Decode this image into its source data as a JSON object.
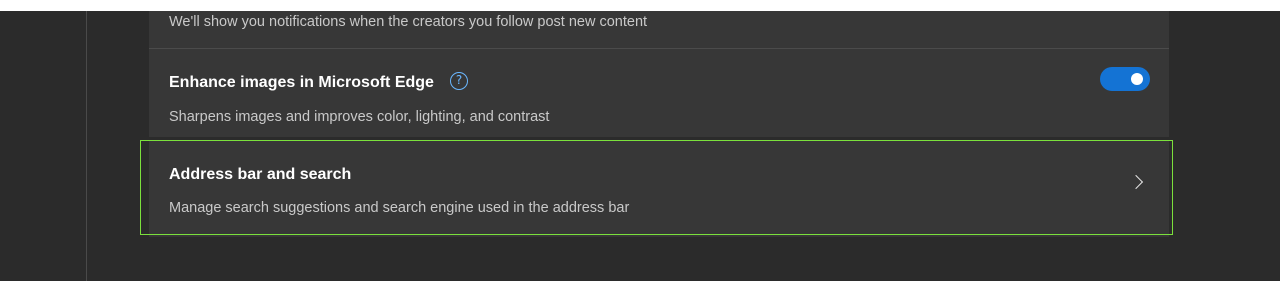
{
  "settings": {
    "notifications_row": {
      "description": "We'll show you notifications when the creators you follow post new content"
    },
    "enhance_images": {
      "title": "Enhance images in Microsoft Edge",
      "help_icon": "question-mark-circle",
      "help_glyph": "?",
      "description": "Sharpens images and improves color, lighting, and contrast",
      "toggle_state": "on",
      "toggle_color": "#1473d4"
    },
    "address_bar": {
      "title": "Address bar and search",
      "description": "Manage search suggestions and search engine used in the address bar",
      "icon": "chevron-right"
    }
  },
  "colors": {
    "background": "#2b2b2b",
    "card": "#373737",
    "highlight": "#7be03c",
    "accent": "#1473d4"
  }
}
